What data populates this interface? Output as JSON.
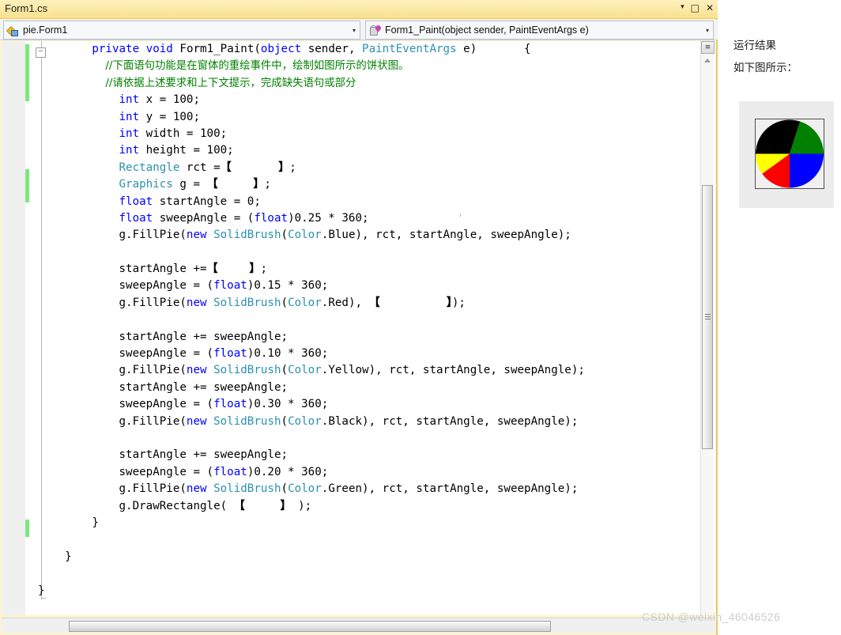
{
  "window": {
    "tab_title": "Form1.cs",
    "btn_dropdown": "▾",
    "btn_maximize": "□",
    "btn_close": "✕"
  },
  "navbar": {
    "class_combo": {
      "value": "pie.Form1",
      "icon": "class-icon",
      "arrow": "▾"
    },
    "member_combo": {
      "value": "Form1_Paint(object sender, PaintEventArgs e)",
      "icon": "method-icon",
      "arrow": "▾"
    }
  },
  "editor": {
    "outline_collapse": "−",
    "split_button": "≡",
    "code_lines": [
      {
        "indent": 8,
        "segments": [
          {
            "t": "private",
            "c": "kw"
          },
          {
            "t": " ",
            "c": ""
          },
          {
            "t": "void",
            "c": "kw"
          },
          {
            "t": " Form1_Paint(",
            "c": ""
          },
          {
            "t": "object",
            "c": "kw"
          },
          {
            "t": " sender, ",
            "c": ""
          },
          {
            "t": "PaintEventArgs",
            "c": "type"
          },
          {
            "t": " e)",
            "c": ""
          },
          {
            "t": "       {",
            "c": ""
          }
        ]
      },
      {
        "indent": 10,
        "segments": [
          {
            "t": "//下面语句功能是在窗体的重绘事件中，绘制如图所示的饼状图。",
            "c": "cmt"
          }
        ]
      },
      {
        "indent": 10,
        "segments": [
          {
            "t": "//请依据上述要求和上下文提示，完成缺失语句或部分",
            "c": "cmt"
          }
        ]
      },
      {
        "indent": 12,
        "segments": [
          {
            "t": "int",
            "c": "kw"
          },
          {
            "t": " x = 100;",
            "c": ""
          }
        ]
      },
      {
        "indent": 12,
        "segments": [
          {
            "t": "int",
            "c": "kw"
          },
          {
            "t": " y = 100;",
            "c": ""
          }
        ]
      },
      {
        "indent": 12,
        "segments": [
          {
            "t": "int",
            "c": "kw"
          },
          {
            "t": " width = 100;",
            "c": ""
          }
        ]
      },
      {
        "indent": 12,
        "segments": [
          {
            "t": "int",
            "c": "kw"
          },
          {
            "t": " height = 100;",
            "c": ""
          }
        ]
      },
      {
        "indent": 12,
        "segments": [
          {
            "t": "Rectangle",
            "c": "type"
          },
          {
            "t": " rct =",
            "c": ""
          },
          {
            "t": "【            】",
            "c": "ph"
          },
          {
            "t": ";",
            "c": ""
          }
        ]
      },
      {
        "indent": 12,
        "segments": [
          {
            "t": "Graphics",
            "c": "type"
          },
          {
            "t": " g = ",
            "c": ""
          },
          {
            "t": "【         】",
            "c": "ph"
          },
          {
            "t": ";",
            "c": ""
          }
        ]
      },
      {
        "indent": 12,
        "segments": [
          {
            "t": "float",
            "c": "kw"
          },
          {
            "t": " startAngle = 0;",
            "c": ""
          }
        ]
      },
      {
        "indent": 12,
        "segments": [
          {
            "t": "float",
            "c": "kw"
          },
          {
            "t": " sweepAngle = (",
            "c": ""
          },
          {
            "t": "float",
            "c": "kw"
          },
          {
            "t": ")0.25 * 360;",
            "c": ""
          }
        ]
      },
      {
        "indent": 12,
        "segments": [
          {
            "t": "g.FillPie(",
            "c": ""
          },
          {
            "t": "new",
            "c": "kw"
          },
          {
            "t": " ",
            "c": ""
          },
          {
            "t": "SolidBrush",
            "c": "type"
          },
          {
            "t": "(",
            "c": ""
          },
          {
            "t": "Color",
            "c": "type"
          },
          {
            "t": ".Blue), rct, startAngle, sweepAngle);",
            "c": ""
          }
        ]
      },
      {
        "indent": 0,
        "segments": []
      },
      {
        "indent": 12,
        "segments": [
          {
            "t": "startAngle +=",
            "c": ""
          },
          {
            "t": "【        】",
            "c": "ph"
          },
          {
            "t": ";",
            "c": ""
          }
        ]
      },
      {
        "indent": 12,
        "segments": [
          {
            "t": "sweepAngle = (",
            "c": ""
          },
          {
            "t": "float",
            "c": "kw"
          },
          {
            "t": ")0.15 * 360;",
            "c": ""
          }
        ]
      },
      {
        "indent": 12,
        "segments": [
          {
            "t": "g.FillPie(",
            "c": ""
          },
          {
            "t": "new",
            "c": "kw"
          },
          {
            "t": " ",
            "c": ""
          },
          {
            "t": "SolidBrush",
            "c": "type"
          },
          {
            "t": "(",
            "c": ""
          },
          {
            "t": "Color",
            "c": "type"
          },
          {
            "t": ".Red), ",
            "c": ""
          },
          {
            "t": "【                 】",
            "c": "ph"
          },
          {
            "t": ");",
            "c": ""
          }
        ]
      },
      {
        "indent": 0,
        "segments": []
      },
      {
        "indent": 12,
        "segments": [
          {
            "t": "startAngle += sweepAngle;",
            "c": ""
          }
        ]
      },
      {
        "indent": 12,
        "segments": [
          {
            "t": "sweepAngle = (",
            "c": ""
          },
          {
            "t": "float",
            "c": "kw"
          },
          {
            "t": ")0.10 * 360;",
            "c": ""
          }
        ]
      },
      {
        "indent": 12,
        "segments": [
          {
            "t": "g.FillPie(",
            "c": ""
          },
          {
            "t": "new",
            "c": "kw"
          },
          {
            "t": " ",
            "c": ""
          },
          {
            "t": "SolidBrush",
            "c": "type"
          },
          {
            "t": "(",
            "c": ""
          },
          {
            "t": "Color",
            "c": "type"
          },
          {
            "t": ".Yellow), rct, startAngle, sweepAngle);",
            "c": ""
          }
        ]
      },
      {
        "indent": 12,
        "segments": [
          {
            "t": "startAngle += sweepAngle;",
            "c": ""
          }
        ]
      },
      {
        "indent": 12,
        "segments": [
          {
            "t": "sweepAngle = (",
            "c": ""
          },
          {
            "t": "float",
            "c": "kw"
          },
          {
            "t": ")0.30 * 360;",
            "c": ""
          }
        ]
      },
      {
        "indent": 12,
        "segments": [
          {
            "t": "g.FillPie(",
            "c": ""
          },
          {
            "t": "new",
            "c": "kw"
          },
          {
            "t": " ",
            "c": ""
          },
          {
            "t": "SolidBrush",
            "c": "type"
          },
          {
            "t": "(",
            "c": ""
          },
          {
            "t": "Color",
            "c": "type"
          },
          {
            "t": ".Black), rct, startAngle, sweepAngle);",
            "c": ""
          }
        ]
      },
      {
        "indent": 0,
        "segments": []
      },
      {
        "indent": 12,
        "segments": [
          {
            "t": "startAngle += sweepAngle;",
            "c": ""
          }
        ]
      },
      {
        "indent": 12,
        "segments": [
          {
            "t": "sweepAngle = (",
            "c": ""
          },
          {
            "t": "float",
            "c": "kw"
          },
          {
            "t": ")0.20 * 360;",
            "c": ""
          }
        ]
      },
      {
        "indent": 12,
        "segments": [
          {
            "t": "g.FillPie(",
            "c": ""
          },
          {
            "t": "new",
            "c": "kw"
          },
          {
            "t": " ",
            "c": ""
          },
          {
            "t": "SolidBrush",
            "c": "type"
          },
          {
            "t": "(",
            "c": ""
          },
          {
            "t": "Color",
            "c": "type"
          },
          {
            "t": ".Green), rct, startAngle, sweepAngle);",
            "c": ""
          }
        ]
      },
      {
        "indent": 12,
        "segments": [
          {
            "t": "g.DrawRectangle( ",
            "c": ""
          },
          {
            "t": "【         】",
            "c": "ph"
          },
          {
            "t": " );",
            "c": ""
          }
        ]
      },
      {
        "indent": 8,
        "segments": [
          {
            "t": "}",
            "c": ""
          }
        ]
      },
      {
        "indent": 0,
        "segments": []
      },
      {
        "indent": 4,
        "segments": [
          {
            "t": "}",
            "c": ""
          }
        ]
      },
      {
        "indent": 0,
        "segments": []
      },
      {
        "indent": 0,
        "segments": [
          {
            "t": "}",
            "c": ""
          }
        ]
      }
    ]
  },
  "right_pane": {
    "line1": "运行结果",
    "line2": "如下图所示："
  },
  "chart_data": {
    "type": "pie",
    "title": "",
    "categories": [
      "Blue",
      "Red",
      "Yellow",
      "Black",
      "Green"
    ],
    "values": [
      0.25,
      0.15,
      0.1,
      0.3,
      0.2
    ],
    "sweep_degrees": [
      90,
      54,
      36,
      108,
      72
    ],
    "start_angle": 0,
    "direction": "clockwise",
    "colors": [
      "#0000FF",
      "#FF0000",
      "#FFFF00",
      "#000000",
      "#008000"
    ],
    "legend": "none",
    "grid": false,
    "border_color": "#505050"
  },
  "watermark": {
    "text": "CSDN @weixin_46046526"
  }
}
